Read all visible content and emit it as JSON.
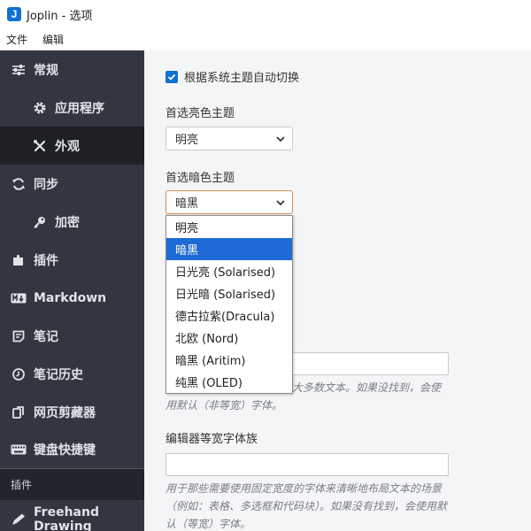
{
  "window": {
    "title": "Joplin - 选项",
    "app_icon_glyph": "J"
  },
  "menubar": {
    "items": [
      "文件",
      "编辑"
    ]
  },
  "sidebar": {
    "items": [
      {
        "label": "常规",
        "icon": "sliders-icon"
      },
      {
        "label": "应用程序",
        "icon": "gear-icon"
      },
      {
        "label": "外观",
        "icon": "paint-tools-icon"
      },
      {
        "label": "同步",
        "icon": "sync-icon"
      },
      {
        "label": "加密",
        "icon": "key-icon"
      },
      {
        "label": "插件",
        "icon": "puzzle-icon"
      },
      {
        "label": "Markdown",
        "icon": "markdown-icon"
      },
      {
        "label": "笔记",
        "icon": "note-icon"
      },
      {
        "label": "笔记历史",
        "icon": "history-icon"
      },
      {
        "label": "网页剪藏器",
        "icon": "clipper-icon"
      },
      {
        "label": "键盘快捷键",
        "icon": "keyboard-icon"
      }
    ],
    "section_label": "插件",
    "plugin_item": {
      "label": "Freehand Drawing",
      "icon": "pen-icon"
    }
  },
  "main": {
    "auto_switch_label": "根据系统主题自动切换",
    "auto_switch_checked": true,
    "light_theme_label": "首选亮色主题",
    "light_theme_value": "明亮",
    "dark_theme_label": "首选暗色主题",
    "dark_theme_value": "暗黑",
    "dropdown_options": [
      "明亮",
      "暗黑",
      "日光亮 (Solarised)",
      "日光暗 (Solarised)",
      "德古拉紫(Dracula)",
      "北欧 (Nord)",
      "暗黑 (Aritim)",
      "纯黑 (OLED)"
    ],
    "dropdown_selected": "暗黑",
    "editor_font_desc_line1": "大多数文本。如果没找到，会使",
    "editor_font_desc_line2": "用默认（非等宽）字体。",
    "mono_font_label": "编辑器等宽字体族",
    "mono_font_value": "",
    "mono_font_desc": "用于那些需要使用固定宽度的字体来清晰地布局文本的场景（例如：表格、多选框和代码块）。如果没有找到，会使用默认（等宽）字体。"
  },
  "colors": {
    "sidebar_bg": "#313640",
    "selected_bg": "#1e2025",
    "accent": "#1071d3",
    "dropdown_highlight": "#1e6ad6"
  }
}
